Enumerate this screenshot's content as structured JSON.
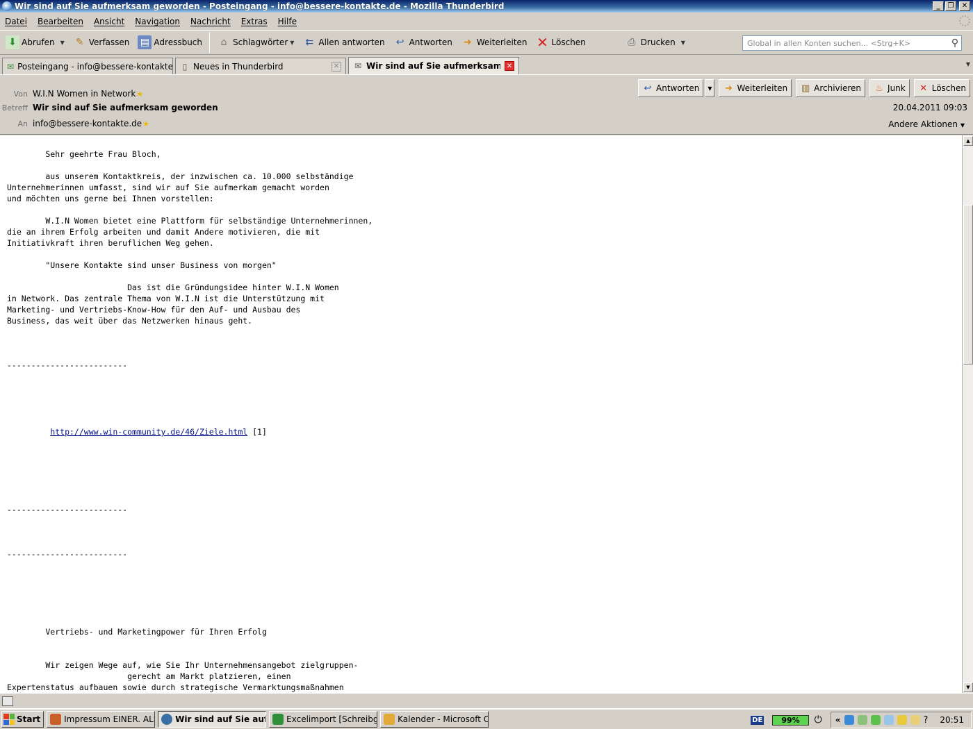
{
  "window": {
    "title": "Wir sind auf Sie aufmerksam geworden - Posteingang - info@bessere-kontakte.de - Mozilla Thunderbird",
    "minimize": "_",
    "restore": "❐",
    "close": "✕"
  },
  "menu": [
    "Datei",
    "Bearbeiten",
    "Ansicht",
    "Navigation",
    "Nachricht",
    "Extras",
    "Hilfe"
  ],
  "toolbar": {
    "abrufen": "Abrufen",
    "verfassen": "Verfassen",
    "adressbuch": "Adressbuch",
    "schlagwoerter": "Schlagwörter",
    "allen_antworten": "Allen antworten",
    "antworten": "Antworten",
    "weiterleiten": "Weiterleiten",
    "loeschen": "Löschen",
    "drucken": "Drucken",
    "search_placeholder": "Global in allen Konten suchen... <Strg+K>"
  },
  "tabs": [
    {
      "label": "Posteingang - info@bessere-kontakte.de",
      "icon": "inbox-icon"
    },
    {
      "label": "Neues in Thunderbird",
      "icon": "page-icon"
    },
    {
      "label": "Wir sind auf Sie aufmerksam gew...",
      "icon": "mail-icon",
      "active": true
    }
  ],
  "header": {
    "from_label": "Von",
    "from": "W.I.N Women in Network",
    "subject_label": "Betreff",
    "subject": "Wir sind auf Sie aufmerksam geworden",
    "to_label": "An",
    "to": "info@bessere-kontakte.de",
    "date": "20.04.2011 09:03",
    "other_actions": "Andere Aktionen",
    "buttons": {
      "reply": "Antworten",
      "forward": "Weiterleiten",
      "archive": "Archivieren",
      "junk": "Junk",
      "delete": "Löschen"
    }
  },
  "body": {
    "greeting": "        Sehr geehrte Frau Bloch,",
    "p1": "        aus unserem Kontaktkreis, der inzwischen ca. 10.000 selbständige\nUnternehmerinnen umfasst, sind wir auf Sie aufmerkam gemacht worden\nund möchten uns gerne bei Ihnen vorstellen:",
    "p2": "        W.I.N Women bietet eine Plattform für selbständige Unternehmerinnen,\ndie an ihrem Erfolg arbeiten und damit Andere motivieren, die mit\nInitiativkraft ihren beruflichen Weg gehen.",
    "quote": "        \"Unsere Kontakte sind unser Business von morgen\"",
    "p3": "                         Das ist die Gründungsidee hinter W.I.N Women\nin Network. Das zentrale Thema von W.I.N ist die Unterstützung mit\nMarketing- und Vertriebs-Know-How für den Auf- und Ausbau des\nBusiness, das weit über das Netzwerken hinaus geht.",
    "separator": "-------------------------",
    "link": "http://www.win-community.de/46/Ziele.html",
    "link_ref": " [1]",
    "heading2": "        Vertriebs- und Marketingpower für Ihren Erfolg",
    "p4": "        Wir zeigen Wege auf, wie Sie Ihr Unternehmensangebot zielgruppen-\n                         gerecht am Markt platzieren, einen\nExpertenstatus aufbauen sowie durch strategische Vermarktungsmaßnahmen\nund Ertrag bringende Kooperationen neue Kundengruppen erschließen"
  },
  "taskbar": {
    "start": "Start",
    "tasks": [
      {
        "label": "Impressum EINER. ALLE....",
        "color": "#c8602a"
      },
      {
        "label": "Wir sind auf Sie aufm...",
        "color": "#3a6ea5",
        "active": true
      },
      {
        "label": "Excelimport [Schreibges...",
        "color": "#2f8f3a"
      },
      {
        "label": "Kalender - Microsoft Outl...",
        "color": "#e2a93a"
      }
    ],
    "lang": "DE",
    "battery": "99%",
    "clock": "20:51"
  }
}
